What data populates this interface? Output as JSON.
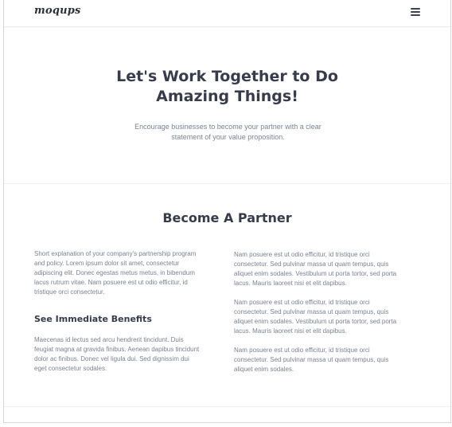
{
  "header": {
    "logo_text": "moqups",
    "menu_icon": "hamburger-menu-icon"
  },
  "hero": {
    "title_line1": "Let's Work Together to Do",
    "title_line2": "Amazing Things!",
    "subtitle": "Encourage businesses to become your partner with a clear statement of your value proposition."
  },
  "partner": {
    "title": "Become A Partner",
    "left": {
      "intro": "Short explanation of your company's partnership program and policy. Lorem ipsum dolor sit amet, consectetur adipiscing elit. Donec egestas metus metus, in bibendum lacus rutrum vitae. Nam posuere est ut odio efficitur, id tristique orci consectetur.",
      "benefits_heading": "See Immediate Benefits",
      "benefits_text": "Maecenas id lectus sed arcu hendrerit tincidunt. Duis feugiat magna at gravida finibus. Aenean dapibus tincidunt dolor ac finibus. Donec vel ligula dui. Sed dignissim dui eget consectetur sodales."
    },
    "right": {
      "paragraphs": [
        "Nam posuere est ut odio efficitur, id tristique orci consectetur. Sed pulvinar massa ut quam tempus, quis aliquet enim sodales. Vestibulum ut porta tortor, sed porta lacus. Mauris laoreet nisi et elit dapibus.",
        "Nam posuere est ut odio efficitur, id tristique orci consectetur. Sed pulvinar massa ut quam tempus, quis aliquet enim sodales. Vestibulum ut porta tortor, sed porta lacus. Mauris laoreet nisi et elit dapibus.",
        "Nam posuere est ut odio efficitur, id tristique orci consectetur. Sed pulvinar massa ut quam tempus, quis aliquet enim sodales."
      ]
    }
  },
  "colors": {
    "heading": "#363c4a",
    "body_text": "#7a8291",
    "divider": "#eef0f3",
    "frame_border": "#d5d8dd"
  }
}
